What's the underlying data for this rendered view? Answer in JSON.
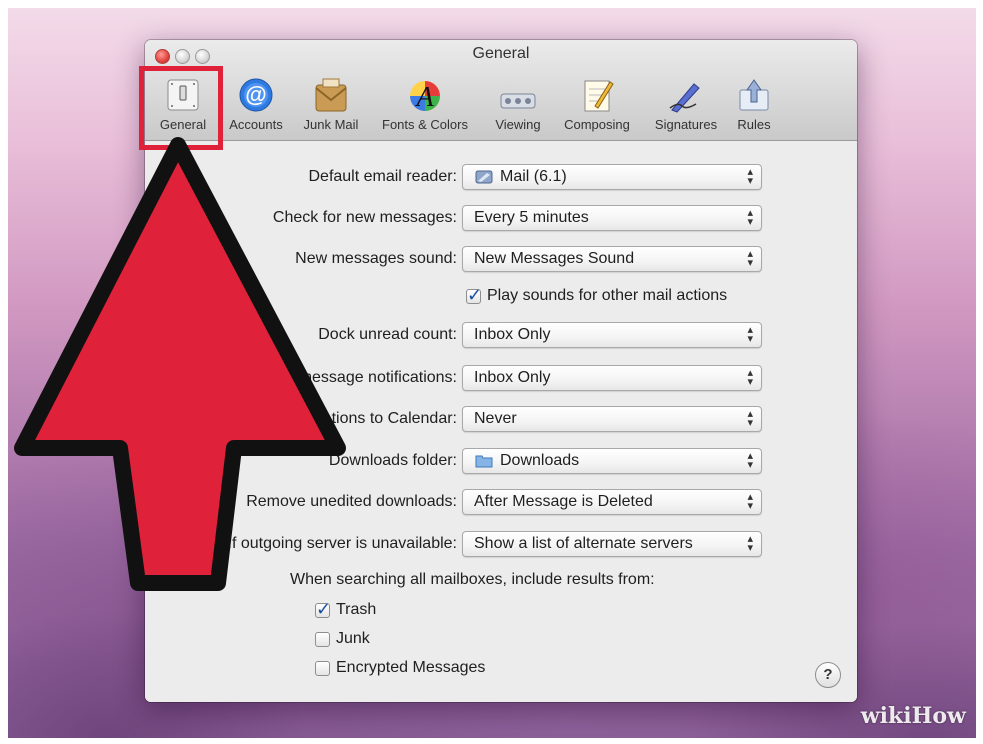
{
  "window": {
    "title": "General"
  },
  "toolbar": {
    "items": [
      {
        "label": "General",
        "icon": "general-switch-icon",
        "selected": true
      },
      {
        "label": "Accounts",
        "icon": "at-sign-icon"
      },
      {
        "label": "Junk Mail",
        "icon": "junk-mail-icon"
      },
      {
        "label": "Fonts & Colors",
        "icon": "fonts-colors-icon"
      },
      {
        "label": "Viewing",
        "icon": "viewing-icon"
      },
      {
        "label": "Composing",
        "icon": "composing-icon"
      },
      {
        "label": "Signatures",
        "icon": "signature-pen-icon"
      },
      {
        "label": "Rules",
        "icon": "rules-icon"
      }
    ]
  },
  "settings": {
    "default_reader": {
      "label": "Default email reader:",
      "value": "Mail (6.1)"
    },
    "check_messages": {
      "label": "Check for new messages:",
      "value": "Every 5 minutes"
    },
    "new_sound": {
      "label": "New messages sound:",
      "value": "New Messages Sound"
    },
    "play_sounds": {
      "label": "Play sounds for other mail actions",
      "checked": true
    },
    "dock_count": {
      "label": "Dock unread count:",
      "value": "Inbox Only"
    },
    "notifications": {
      "label": "New message notifications:",
      "value": "Inbox Only"
    },
    "invitations": {
      "label": "Add invitations to Calendar:",
      "value": "Never"
    },
    "downloads_folder": {
      "label": "Downloads folder:",
      "value": "Downloads"
    },
    "remove_downloads": {
      "label": "Remove unedited downloads:",
      "value": "After Message is Deleted"
    },
    "outgoing": {
      "label": "If outgoing server is unavailable:",
      "value": "Show a list of alternate servers"
    },
    "search_heading": "When searching all mailboxes, include results from:",
    "search_trash": {
      "label": "Trash",
      "checked": true
    },
    "search_junk": {
      "label": "Junk",
      "checked": false
    },
    "search_encrypted": {
      "label": "Encrypted Messages",
      "checked": false
    }
  },
  "help": {
    "symbol": "?"
  },
  "annotation": {
    "arrow_color": "#e0213a",
    "highlight_color": "#e0213a"
  },
  "watermark": "wikiHow"
}
